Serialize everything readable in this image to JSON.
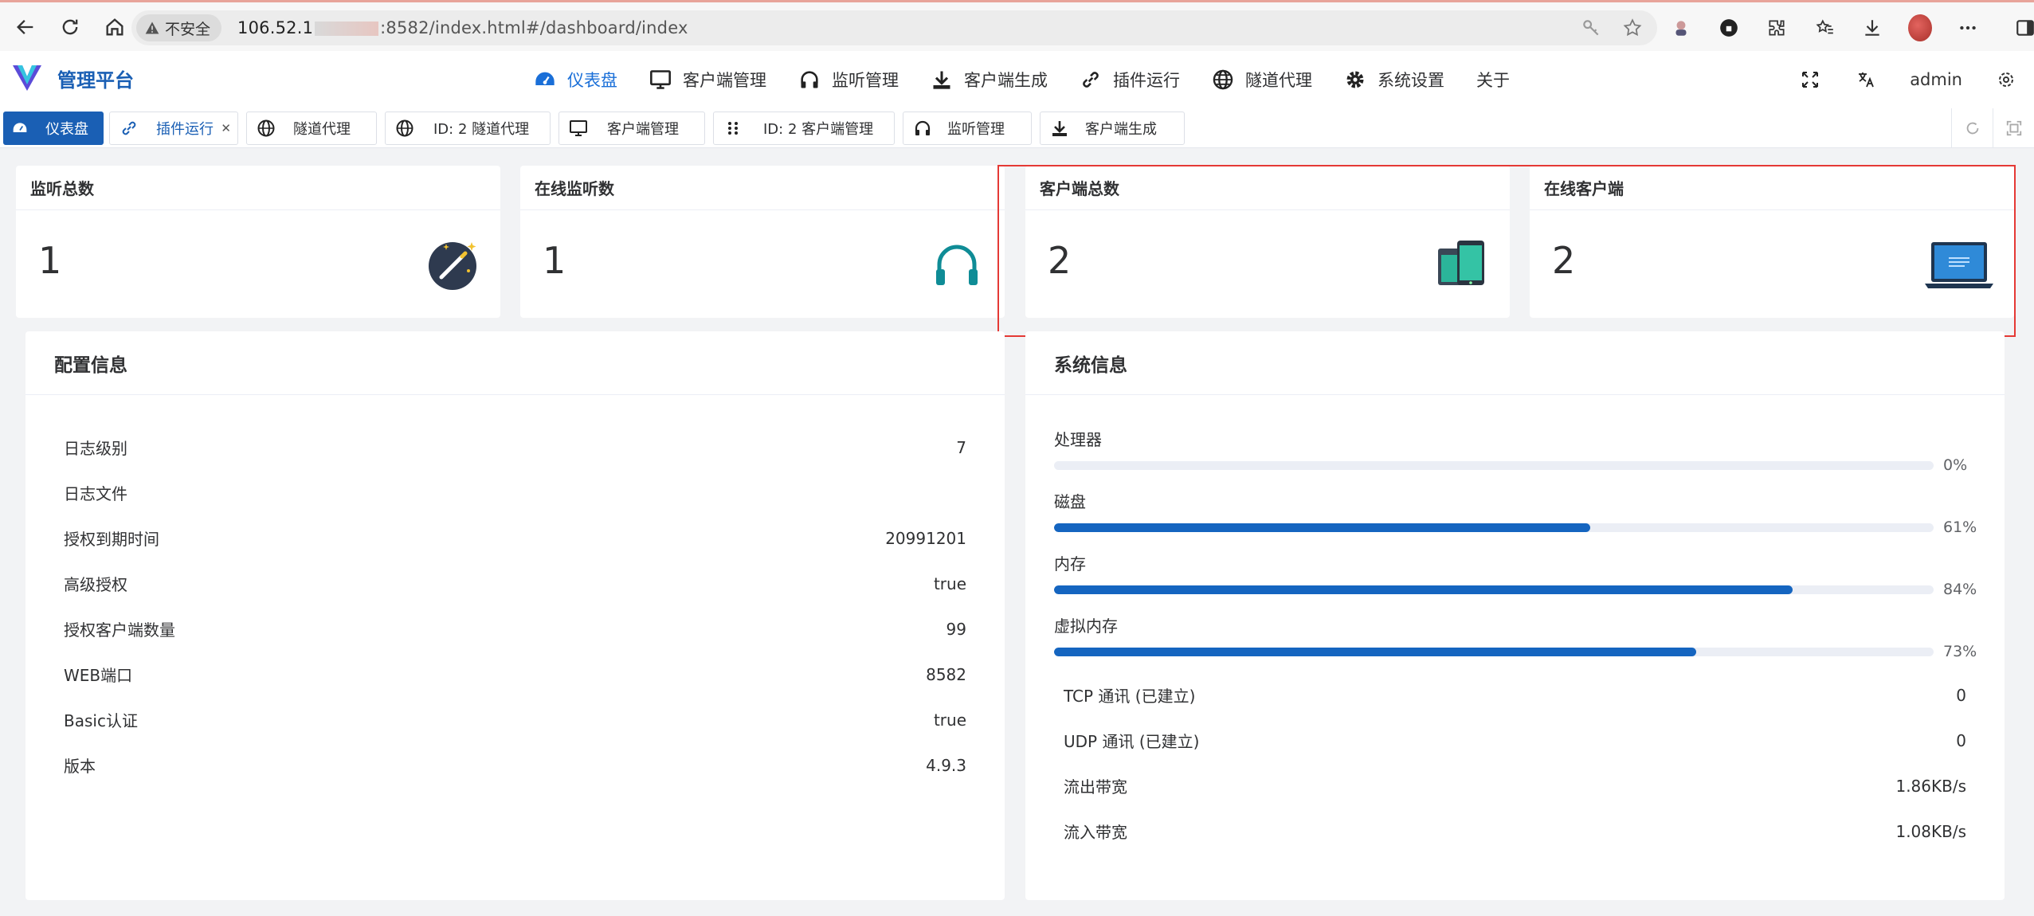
{
  "browser": {
    "security_label": "不安全",
    "url_host": "106.52.1",
    "url_path": ":8582/index.html#/dashboard/index"
  },
  "app": {
    "title": "管理平台",
    "menu": [
      {
        "label": "仪表盘",
        "icon": "dashboard-icon",
        "active": true
      },
      {
        "label": "客户端管理",
        "icon": "monitor-icon"
      },
      {
        "label": "监听管理",
        "icon": "headphones-icon"
      },
      {
        "label": "客户端生成",
        "icon": "download-icon"
      },
      {
        "label": "插件运行",
        "icon": "link-icon"
      },
      {
        "label": "隧道代理",
        "icon": "globe-icon"
      },
      {
        "label": "系统设置",
        "icon": "gear-icon"
      },
      {
        "label": "关于",
        "icon": ""
      }
    ],
    "user": "admin"
  },
  "tabs": [
    {
      "label": "仪表盘",
      "icon": "dashboard-icon",
      "active": true
    },
    {
      "label": "插件运行",
      "icon": "link-icon",
      "closable": true
    },
    {
      "label": "隧道代理",
      "icon": "globe-icon"
    },
    {
      "label": "ID: 2 隧道代理",
      "icon": "globe-icon"
    },
    {
      "label": "客户端管理",
      "icon": "monitor-icon"
    },
    {
      "label": "ID: 2 客户端管理",
      "icon": "grip-icon"
    },
    {
      "label": "监听管理",
      "icon": "headphones-icon"
    },
    {
      "label": "客户端生成",
      "icon": "download-icon"
    }
  ],
  "stats": [
    {
      "title": "监听总数",
      "value": "1",
      "icon": "magic-wand-icon"
    },
    {
      "title": "在线监听数",
      "value": "1",
      "icon": "headphones-icon"
    },
    {
      "title": "客户端总数",
      "value": "2",
      "icon": "devices-icon"
    },
    {
      "title": "在线客户端",
      "value": "2",
      "icon": "laptop-icon"
    }
  ],
  "config": {
    "title": "配置信息",
    "rows": [
      {
        "label": "日志级别",
        "value": "7"
      },
      {
        "label": "日志文件",
        "value": ""
      },
      {
        "label": "授权到期时间",
        "value": "20991201"
      },
      {
        "label": "高级授权",
        "value": "true"
      },
      {
        "label": "授权客户端数量",
        "value": "99"
      },
      {
        "label": "WEB端口",
        "value": "8582"
      },
      {
        "label": "Basic认证",
        "value": "true"
      },
      {
        "label": "版本",
        "value": "4.9.3"
      }
    ]
  },
  "system": {
    "title": "系统信息",
    "bars": [
      {
        "label": "处理器",
        "percent": 0,
        "text": "0%"
      },
      {
        "label": "磁盘",
        "percent": 61,
        "text": "61%"
      },
      {
        "label": "内存",
        "percent": 84,
        "text": "84%"
      },
      {
        "label": "虚拟内存",
        "percent": 73,
        "text": "73%"
      }
    ],
    "rows": [
      {
        "label": "TCP 通讯 (已建立)",
        "value": "0"
      },
      {
        "label": "UDP 通讯 (已建立)",
        "value": "0"
      },
      {
        "label": "流出带宽",
        "value": "1.86KB/s"
      },
      {
        "label": "流入带宽",
        "value": "1.08KB/s"
      }
    ]
  },
  "colors": {
    "accent": "#1a5fb4",
    "bar": "#1565c0",
    "highlight": "#e53935"
  }
}
